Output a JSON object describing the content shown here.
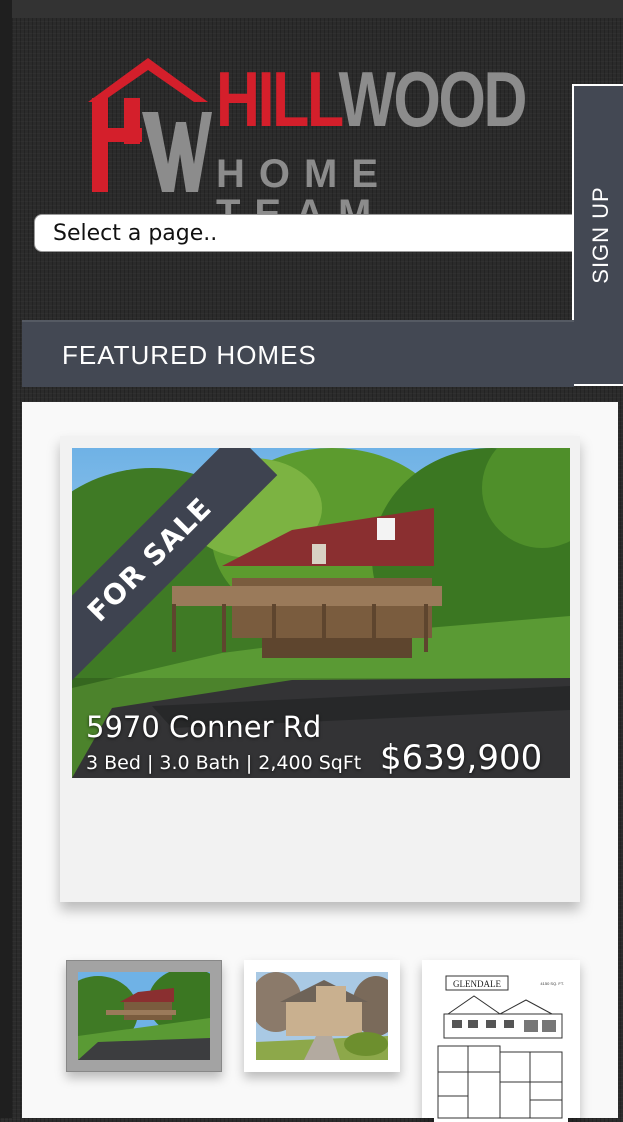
{
  "logo": {
    "word_red": "HILL",
    "word_gray": "WOOD",
    "subtitle": "HOME TEAM",
    "colors": {
      "red": "#d41f2b",
      "gray": "#8c8c8c"
    }
  },
  "nav": {
    "select_value": "Select a page.."
  },
  "signup": {
    "label": "SIGN UP"
  },
  "featured": {
    "heading": "FEATURED HOMES"
  },
  "listing": {
    "banner": "FOR SALE",
    "address": "5970 Conner Rd",
    "specs": "3 Bed | 3.0 Bath | 2,400 SqFt",
    "price": "$639,900"
  },
  "thumbnails": [
    {
      "name": "house-thumb-1",
      "active": true
    },
    {
      "name": "house-thumb-2",
      "active": false
    },
    {
      "name": "floorplan-thumb",
      "title": "GLENDALE",
      "sqft": "4150 SQ. FT."
    }
  ],
  "colors": {
    "dark_bar": "#434853",
    "background": "#2b2b2b",
    "panel": "#f9f9f9"
  }
}
